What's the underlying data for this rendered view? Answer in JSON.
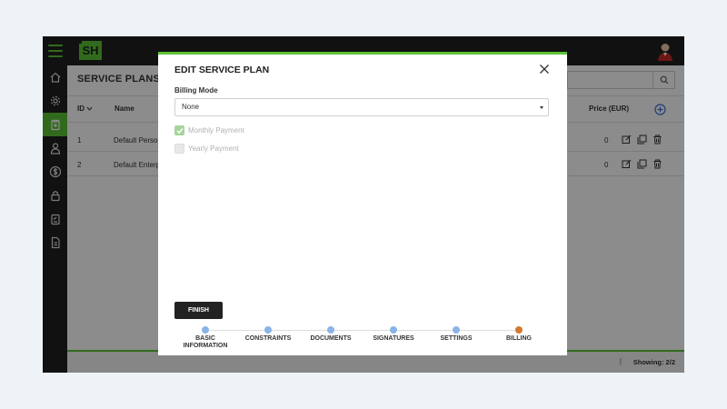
{
  "logo": "SH",
  "page": {
    "title": "SERVICE PLANS"
  },
  "table": {
    "headers": {
      "id": "ID",
      "name": "Name",
      "price": "Price (EUR)"
    },
    "rows": [
      {
        "id": "1",
        "name": "Default Perso",
        "price": "0"
      },
      {
        "id": "2",
        "name": "Default Enterp",
        "price": "0"
      }
    ]
  },
  "footer": {
    "separator": "|",
    "showing": "Showing: 2/2"
  },
  "modal": {
    "title": "EDIT SERVICE PLAN",
    "billing_mode_label": "Billing Mode",
    "billing_mode_value": "None",
    "options": [
      {
        "label": "Monthly Payment",
        "checked": true
      },
      {
        "label": "Yearly Payment",
        "checked": false
      }
    ],
    "finish_label": "FINISH",
    "steps": [
      {
        "line1": "BASIC",
        "line2": "INFORMATION"
      },
      {
        "line1": "CONSTRAINTS",
        "line2": ""
      },
      {
        "line1": "DOCUMENTS",
        "line2": ""
      },
      {
        "line1": "SIGNATURES",
        "line2": ""
      },
      {
        "line1": "SETTINGS",
        "line2": ""
      },
      {
        "line1": "BILLING",
        "line2": ""
      }
    ],
    "current_step": 5
  },
  "colors": {
    "accent": "#5bc236",
    "step_done": "#8ab4e8",
    "step_current": "#d27a2c"
  },
  "icons": {
    "sidebar": [
      "home-icon",
      "gear-icon",
      "clipboard-icon",
      "user-icon",
      "dollar-icon",
      "lock-icon",
      "checklist-icon",
      "document-icon"
    ]
  }
}
